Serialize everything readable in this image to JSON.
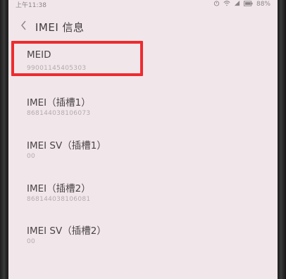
{
  "status_bar": {
    "time": "上午11:38",
    "icons": [
      "alarm-icon",
      "wifi-icon",
      "signal-icon",
      "battery-icon"
    ],
    "battery": "88%"
  },
  "header": {
    "back_icon": "chevron-left-icon",
    "title": "IMEI 信息"
  },
  "items": [
    {
      "label": "MEID",
      "value": "99001145405303"
    },
    {
      "label": "IMEI（插槽1）",
      "value": "868144038106073"
    },
    {
      "label": "IMEI SV（插槽1）",
      "value": "00"
    },
    {
      "label": "IMEI（插槽2）",
      "value": "868144038106081"
    },
    {
      "label": "IMEI SV（插槽2）",
      "value": "00"
    }
  ],
  "colors": {
    "background": "#f1e7ea",
    "highlight": "#ee2b30",
    "primary_text": "#4a4446",
    "secondary_text": "#b3abae"
  }
}
